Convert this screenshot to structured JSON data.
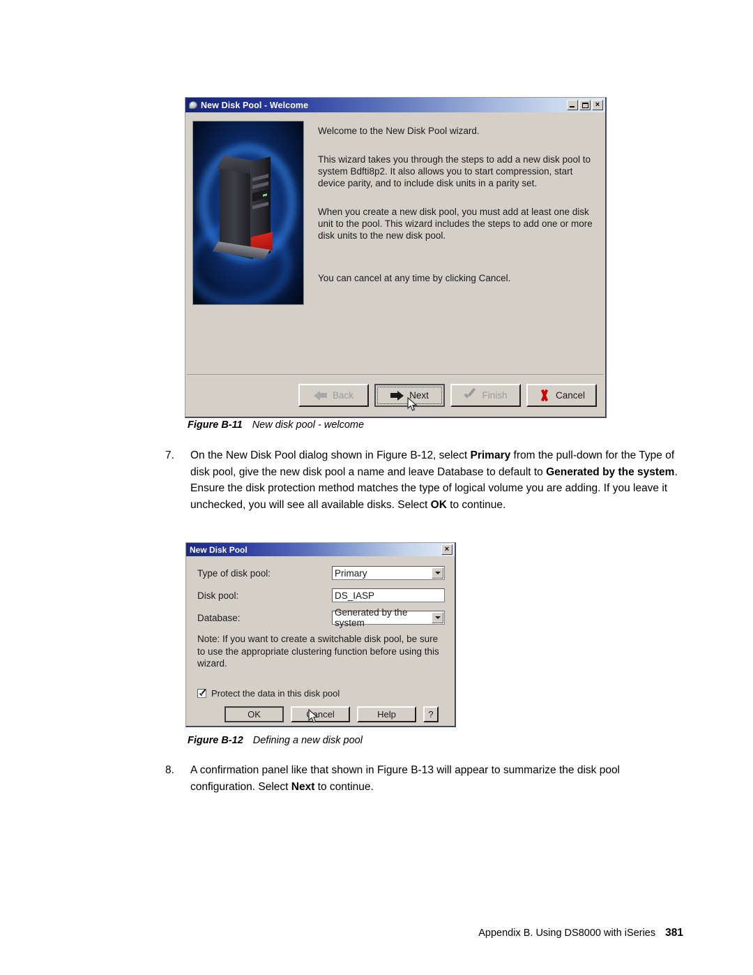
{
  "page": {
    "footer_text": "Appendix B. Using DS8000 with iSeries",
    "page_number": "381"
  },
  "figure1": {
    "caption_label": "Figure B-11",
    "caption_text": "New disk pool - welcome",
    "window": {
      "title": "New Disk Pool - Welcome",
      "title_icon": "disk-pool-icon",
      "controls": {
        "minimize": "minimize-icon",
        "maximize": "maximize-icon",
        "close": "×"
      },
      "image_alt": "iSeries server tower illustration",
      "paragraphs": [
        "Welcome to the New Disk Pool wizard.",
        "This wizard takes you through the steps to add a new disk pool to system Bdfti8p2.  It also allows you to start compression, start device parity, and to include disk units in a parity set.",
        "When you create a new disk pool, you must add at least one disk unit to the pool. This wizard includes the steps to add one or more disk units to the new disk pool.",
        "You can cancel at any time by clicking Cancel."
      ],
      "buttons": [
        {
          "label": "Back",
          "icon": "arrow-left-icon",
          "state": "disabled"
        },
        {
          "label": "Next",
          "icon": "arrow-right-icon",
          "state": "focused"
        },
        {
          "label": "Finish",
          "icon": "checkmark-icon",
          "state": "disabled"
        },
        {
          "label": "Cancel",
          "icon": "red-x-icon",
          "state": "enabled"
        }
      ]
    }
  },
  "step7": {
    "number": "7.",
    "parts": [
      {
        "text": "On the New Disk Pool dialog shown in Figure B-12, select ",
        "bold": false
      },
      {
        "text": "Primary",
        "bold": true
      },
      {
        "text": " from the pull-down for the Type of disk pool, give the new disk pool a name and leave Database to default to ",
        "bold": false
      },
      {
        "text": "Generated by the system",
        "bold": true
      },
      {
        "text": ". Ensure the disk protection method matches the type of logical volume you are adding. If you leave it unchecked, you will see all available disks. Select ",
        "bold": false
      },
      {
        "text": "OK",
        "bold": true
      },
      {
        "text": " to continue.",
        "bold": false
      }
    ]
  },
  "figure2": {
    "caption_label": "Figure B-12",
    "caption_text": "Defining a new disk pool",
    "window": {
      "title": "New Disk Pool",
      "close_label": "×",
      "fields": [
        {
          "label": "Type of disk pool:",
          "control": "combobox",
          "value": "Primary"
        },
        {
          "label": "Disk pool:",
          "control": "textbox",
          "value": "DS_IASP"
        },
        {
          "label": "Database:",
          "control": "combobox",
          "value": "Generated by the system"
        }
      ],
      "note": "Note:  If you want to create a switchable disk pool, be sure to use the appropriate clustering function before using this wizard.",
      "checkbox": {
        "label": "Protect the data in this disk pool",
        "checked": true
      },
      "buttons": [
        {
          "label": "OK",
          "state": "default"
        },
        {
          "label": "Cancel",
          "state": "enabled"
        },
        {
          "label": "Help",
          "state": "enabled"
        },
        {
          "label": "?",
          "state": "enabled"
        }
      ]
    }
  },
  "step8": {
    "number": "8.",
    "parts": [
      {
        "text": "A confirmation panel like that shown in Figure B-13 will appear to summarize the disk pool configuration. Select ",
        "bold": false
      },
      {
        "text": "Next",
        "bold": true
      },
      {
        "text": " to continue.",
        "bold": false
      }
    ]
  }
}
